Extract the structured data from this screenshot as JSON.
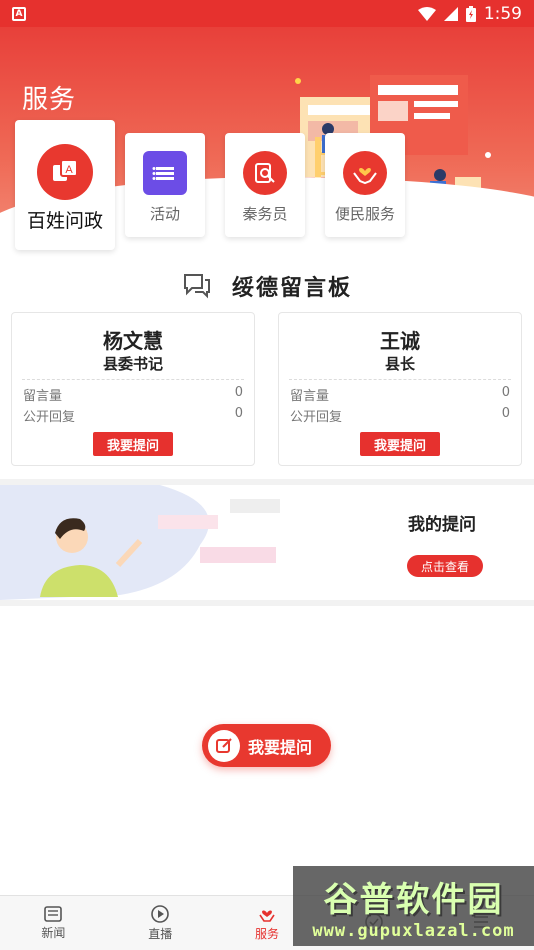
{
  "status_bar": {
    "time": "1:59",
    "left_icon": "A"
  },
  "hero": {
    "title": "服务"
  },
  "services": [
    {
      "label": "百姓问政",
      "icon": "consult-icon"
    },
    {
      "label": "活动",
      "icon": "activity-icon"
    },
    {
      "label": "秦务员",
      "icon": "search-doc-icon"
    },
    {
      "label": "便民服务",
      "icon": "hands-heart-icon"
    }
  ],
  "board": {
    "title": "绥德留言板",
    "people": [
      {
        "name": "杨文慧",
        "title": "县委书记",
        "messages_label": "留言量",
        "messages": "0",
        "replies_label": "公开回复",
        "replies": "0",
        "ask_label": "我要提问"
      },
      {
        "name": "王诚",
        "title": "县长",
        "messages_label": "留言量",
        "messages": "0",
        "replies_label": "公开回复",
        "replies": "0",
        "ask_label": "我要提问"
      }
    ]
  },
  "my_questions": {
    "title": "我的提问",
    "button": "点击查看"
  },
  "fab": {
    "label": "我要提问"
  },
  "tabs": [
    {
      "label": "新闻",
      "icon": "news-icon"
    },
    {
      "label": "直播",
      "icon": "play-icon"
    },
    {
      "label": "服务",
      "icon": "service-icon",
      "active": true
    },
    {
      "label": "",
      "icon": "check-icon"
    },
    {
      "label": "",
      "icon": "menu-icon"
    }
  ],
  "watermark": {
    "main": "谷普软件园",
    "url": "www.gupuxlazal.com"
  },
  "colors": {
    "accent": "#e6312e",
    "hero_gradient_start": "#e8403a",
    "hero_gradient_end": "#f4937f"
  }
}
